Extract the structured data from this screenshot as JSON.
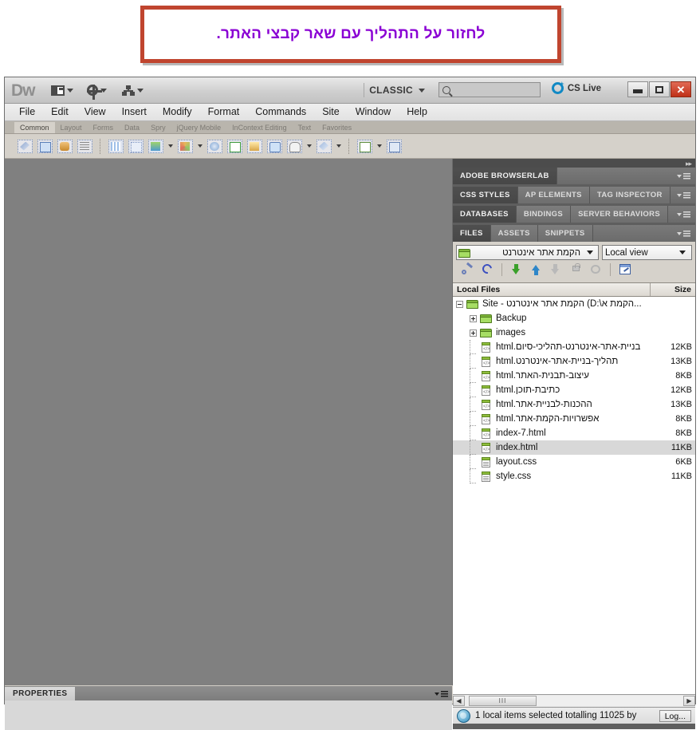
{
  "banner": {
    "text": "לחזור על התהליך עם שאר קבצי האתר."
  },
  "titlebar": {
    "logo": "Dw",
    "workspace": "CLASSIC",
    "search_placeholder": "",
    "search_value": "",
    "cs_live": "CS Live",
    "layout_icon": "layout-icon",
    "extend_icon": "gear-icon",
    "site_icon": "site-icon",
    "minimize_icon": "minimize-icon",
    "maximize_icon": "maximize-icon",
    "close_icon": "close-icon"
  },
  "menubar": {
    "items": [
      {
        "label": "File"
      },
      {
        "label": "Edit"
      },
      {
        "label": "View"
      },
      {
        "label": "Insert"
      },
      {
        "label": "Modify"
      },
      {
        "label": "Format"
      },
      {
        "label": "Commands"
      },
      {
        "label": "Site"
      },
      {
        "label": "Window"
      },
      {
        "label": "Help"
      }
    ]
  },
  "insertbar": {
    "tabs": [
      {
        "label": "Common",
        "active": true
      },
      {
        "label": "Layout",
        "active": false
      },
      {
        "label": "Forms",
        "active": false
      },
      {
        "label": "Data",
        "active": false
      },
      {
        "label": "Spry",
        "active": false
      },
      {
        "label": "jQuery Mobile",
        "active": false
      },
      {
        "label": "InContext Editing",
        "active": false
      },
      {
        "label": "Text",
        "active": false
      },
      {
        "label": "Favorites",
        "active": false
      }
    ]
  },
  "properties_panel": {
    "tab_label": "PROPERTIES"
  },
  "dock": {
    "groups": [
      {
        "tabs": [
          {
            "label": "ADOBE BROWSERLAB",
            "active": true
          }
        ]
      },
      {
        "tabs": [
          {
            "label": "CSS STYLES",
            "active": true
          },
          {
            "label": "AP ELEMENTS",
            "active": false
          },
          {
            "label": "TAG INSPECTOR",
            "active": false
          }
        ]
      },
      {
        "tabs": [
          {
            "label": "DATABASES",
            "active": true
          },
          {
            "label": "BINDINGS",
            "active": false
          },
          {
            "label": "SERVER BEHAVIORS",
            "active": false
          }
        ]
      },
      {
        "tabs": [
          {
            "label": "FILES",
            "active": true
          },
          {
            "label": "ASSETS",
            "active": false
          },
          {
            "label": "SNIPPETS",
            "active": false
          }
        ]
      }
    ]
  },
  "files_panel": {
    "site_select": "הקמת אתר אינטרנט",
    "view_select": "Local view",
    "toolbar_icons": [
      "connect-to-remote-host-icon",
      "refresh-icon",
      "get-files-icon",
      "put-files-icon",
      "check-out-icon",
      "check-in-icon",
      "synchronize-icon",
      "expand-collapse-icon"
    ],
    "columns": {
      "name": "Local Files",
      "size": "Size"
    },
    "rows": [
      {
        "name": "Site - הקמת אתר אינטרנט (D:\\הקמת א...",
        "size": "",
        "type": "folder",
        "depth": 0,
        "toggle": "minus",
        "rtl": false,
        "selected": false
      },
      {
        "name": "Backup",
        "size": "",
        "type": "folder",
        "depth": 1,
        "toggle": "plus",
        "rtl": false,
        "selected": false
      },
      {
        "name": "images",
        "size": "",
        "type": "folder",
        "depth": 1,
        "toggle": "plus",
        "rtl": false,
        "selected": false
      },
      {
        "name": "בניית-אתר-אינטרנט-תהליכי-סיום.html",
        "size": "12KB",
        "type": "doc",
        "depth": 1,
        "toggle": "none",
        "rtl": true,
        "selected": false
      },
      {
        "name": "תהליך-בניית-אתר-אינטרנט.html",
        "size": "13KB",
        "type": "doc",
        "depth": 1,
        "toggle": "none",
        "rtl": true,
        "selected": false
      },
      {
        "name": "עיצוב-תבנית-האתר.html",
        "size": "8KB",
        "type": "doc",
        "depth": 1,
        "toggle": "none",
        "rtl": true,
        "selected": false
      },
      {
        "name": "כתיבת-תוכן.html",
        "size": "12KB",
        "type": "doc",
        "depth": 1,
        "toggle": "none",
        "rtl": true,
        "selected": false
      },
      {
        "name": "ההכנות-לבניית-אתר.html",
        "size": "13KB",
        "type": "doc",
        "depth": 1,
        "toggle": "none",
        "rtl": true,
        "selected": false
      },
      {
        "name": "אפשרויות-הקמת-אתר.html",
        "size": "8KB",
        "type": "doc",
        "depth": 1,
        "toggle": "none",
        "rtl": true,
        "selected": false
      },
      {
        "name": "index-7.html",
        "size": "8KB",
        "type": "doc",
        "depth": 1,
        "toggle": "none",
        "rtl": false,
        "selected": false
      },
      {
        "name": "index.html",
        "size": "11KB",
        "type": "doc",
        "depth": 1,
        "toggle": "none",
        "rtl": false,
        "selected": true
      },
      {
        "name": "layout.css",
        "size": "6KB",
        "type": "css",
        "depth": 1,
        "toggle": "none",
        "rtl": false,
        "selected": false
      },
      {
        "name": "style.css",
        "size": "11KB",
        "type": "css",
        "depth": 1,
        "toggle": "none",
        "rtl": false,
        "selected": false
      }
    ],
    "scroll": {
      "left_arrow": "◀",
      "right_arrow": "▶",
      "thumb_grip": "III"
    },
    "status": {
      "text": "1 local items selected totalling 11025 by",
      "log_button": "Log..."
    }
  },
  "colors": {
    "banner_border": "#c0452f",
    "banner_text": "#8a00d4",
    "canvas": "#808080",
    "dock_bg": "#5e5e5e",
    "selected_row": "#d8d8d8"
  }
}
